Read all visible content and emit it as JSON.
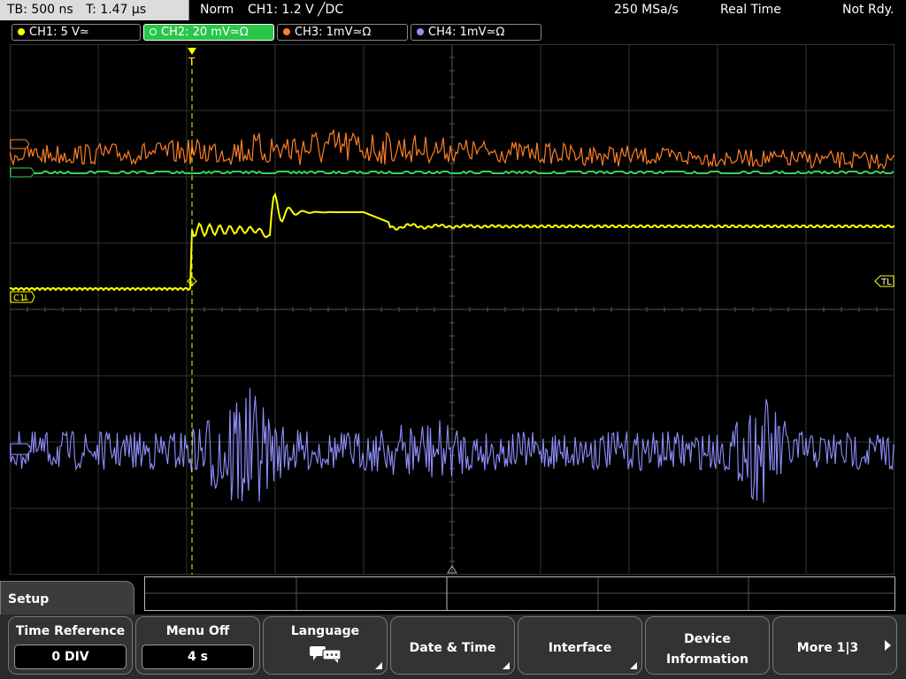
{
  "status": {
    "timebase": "TB: 500 ns",
    "trigger_time": "T: 1.47 µs",
    "trigger_mode": "Norm",
    "trigger_source": "CH1: 1.2 V ╱DC",
    "sample_rate": "250 MSa/s",
    "acq_mode": "Real Time",
    "state": "Not Rdy."
  },
  "channels": [
    {
      "label": "CH1: 5 V≃",
      "color": "#ffff00",
      "active": false
    },
    {
      "label": "CH2: 20 mV≃Ω",
      "color": "#39d353",
      "active": true
    },
    {
      "label": "CH3: 1mV≃Ω",
      "color": "#ff7f27",
      "active": false
    },
    {
      "label": "CH4: 1mV≃Ω",
      "color": "#8f8fff",
      "active": false
    }
  ],
  "markers": {
    "ch1_ground": "C1",
    "trigger_level": "TL",
    "trigger_pos": "T"
  },
  "setup": {
    "title": "Setup"
  },
  "softkeys": {
    "time_reference": {
      "label": "Time Reference",
      "value": "0 DIV"
    },
    "menu_off": {
      "label": "Menu Off",
      "value": "4 s"
    },
    "language": {
      "label": "Language",
      "icon": "speech-bubbles-icon"
    },
    "date_time": {
      "label": "Date & Time"
    },
    "interface": {
      "label": "Interface"
    },
    "device_info": {
      "label_line1": "Device",
      "label_line2": "Information"
    },
    "more": {
      "label": "More 1|3"
    }
  },
  "colors": {
    "ch1": "#ffff00",
    "ch2": "#39d353",
    "ch3": "#ff7f27",
    "ch4": "#8f8fff",
    "grid": "#4a4a4a"
  }
}
